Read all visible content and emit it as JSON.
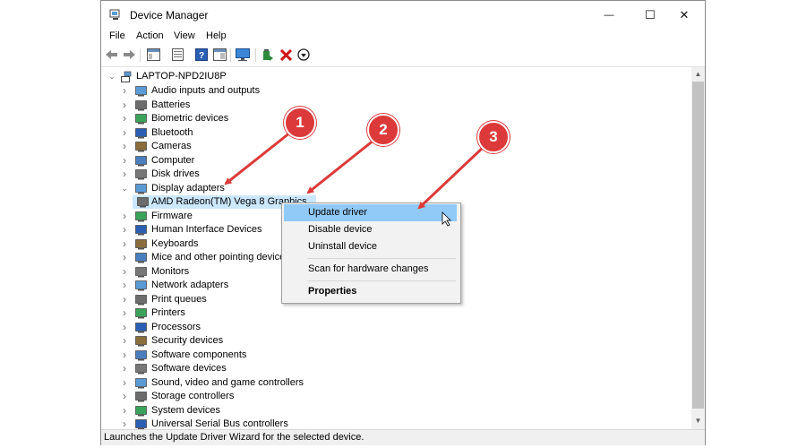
{
  "window": {
    "title": "Device Manager",
    "minimize": "—",
    "maximize": "☐",
    "close": "✕"
  },
  "menu": [
    "File",
    "Action",
    "View",
    "Help"
  ],
  "tree": {
    "root": "LAPTOP-NPD2IU8P",
    "items": [
      {
        "label": "Audio inputs and outputs",
        "icon": "speaker-icon"
      },
      {
        "label": "Batteries",
        "icon": "battery-icon"
      },
      {
        "label": "Biometric devices",
        "icon": "fingerprint-icon"
      },
      {
        "label": "Bluetooth",
        "icon": "bluetooth-icon"
      },
      {
        "label": "Cameras",
        "icon": "camera-icon"
      },
      {
        "label": "Computer",
        "icon": "computer-icon"
      },
      {
        "label": "Disk drives",
        "icon": "disk-drive-icon"
      },
      {
        "label": "Display adapters",
        "icon": "display-adapter-icon",
        "expanded": true
      },
      {
        "label": "AMD Radeon(TM) Vega 8 Graphics",
        "icon": "display-adapter-icon",
        "child": true
      },
      {
        "label": "Firmware",
        "icon": "firmware-icon"
      },
      {
        "label": "Human Interface Devices",
        "icon": "hid-icon"
      },
      {
        "label": "Keyboards",
        "icon": "keyboard-icon"
      },
      {
        "label": "Mice and other pointing devices",
        "icon": "mouse-icon"
      },
      {
        "label": "Monitors",
        "icon": "monitor-icon"
      },
      {
        "label": "Network adapters",
        "icon": "network-icon"
      },
      {
        "label": "Print queues",
        "icon": "print-queue-icon"
      },
      {
        "label": "Printers",
        "icon": "printer-icon"
      },
      {
        "label": "Processors",
        "icon": "processor-icon"
      },
      {
        "label": "Security devices",
        "icon": "security-device-icon"
      },
      {
        "label": "Software components",
        "icon": "software-component-icon"
      },
      {
        "label": "Software devices",
        "icon": "software-device-icon"
      },
      {
        "label": "Sound, video and game controllers",
        "icon": "sound-icon"
      },
      {
        "label": "Storage controllers",
        "icon": "storage-icon"
      },
      {
        "label": "System devices",
        "icon": "system-device-icon"
      },
      {
        "label": "Universal Serial Bus controllers",
        "icon": "usb-icon"
      }
    ]
  },
  "context_menu": {
    "update": "Update driver",
    "disable": "Disable device",
    "uninstall": "Uninstall device",
    "scan": "Scan for hardware changes",
    "properties": "Properties"
  },
  "annotations": [
    "1",
    "2",
    "3"
  ],
  "status": "Launches the Update Driver Wizard for the selected device.",
  "colors": {
    "selection": "#cce8ff",
    "menu_highlight": "#91c9f7",
    "annotation_red": "#dc3a3a"
  }
}
